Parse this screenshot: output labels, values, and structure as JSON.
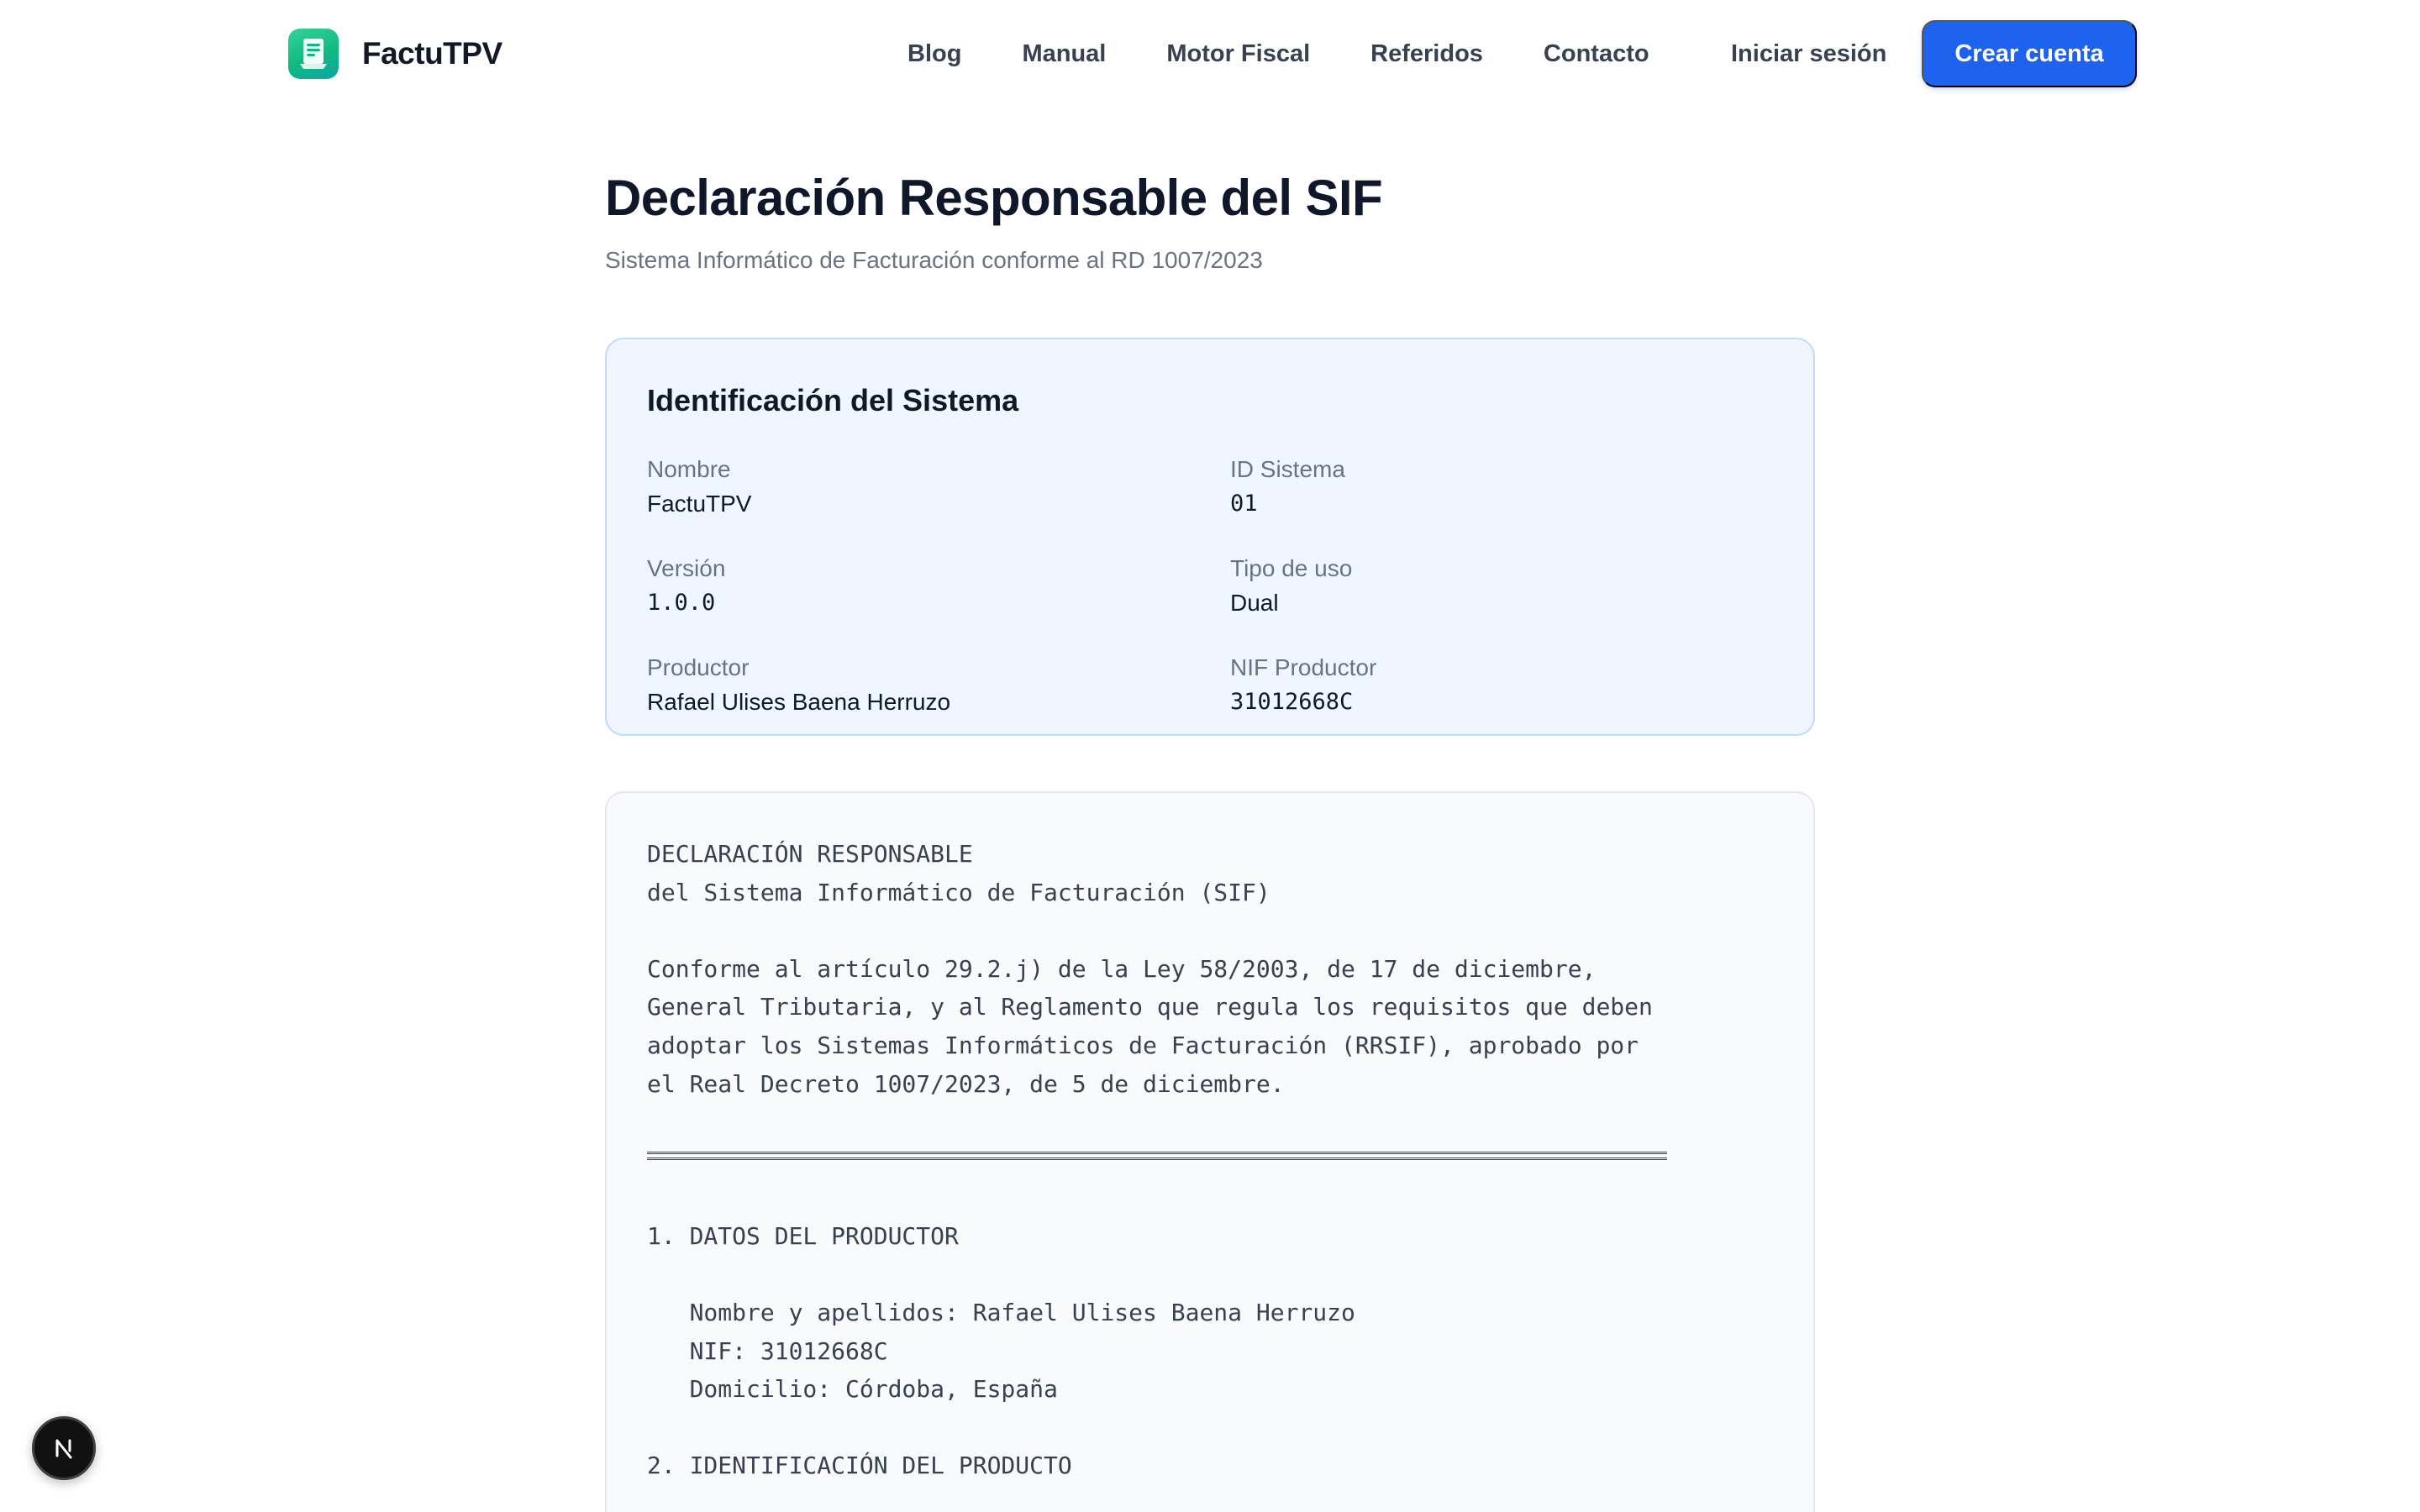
{
  "header": {
    "brand": "FactuTPV",
    "nav": [
      "Blog",
      "Manual",
      "Motor Fiscal",
      "Referidos",
      "Contacto"
    ],
    "login": "Iniciar sesión",
    "cta": "Crear cuenta"
  },
  "page": {
    "title": "Declaración Responsable del SIF",
    "subtitle": "Sistema Informático de Facturación conforme al RD 1007/2023"
  },
  "identification": {
    "title": "Identificación del Sistema",
    "fields": [
      {
        "label": "Nombre",
        "value": "FactuTPV"
      },
      {
        "label": "ID Sistema",
        "value": "01"
      },
      {
        "label": "Versión",
        "value": "1.0.0"
      },
      {
        "label": "Tipo de uso",
        "value": "Dual"
      },
      {
        "label": "Productor",
        "value": "Rafael Ulises Baena Herruzo"
      },
      {
        "label": "NIF Productor",
        "value": "31012668C"
      }
    ]
  },
  "declaration": {
    "heading1": "DECLARACIÓN RESPONSABLE",
    "heading2": "del Sistema Informático de Facturación (SIF)",
    "intro": [
      "Conforme al artículo 29.2.j) de la Ley 58/2003, de 17 de diciembre,",
      "General Tributaria, y al Reglamento que regula los requisitos que deben",
      "adoptar los Sistemas Informáticos de Facturación (RRSIF), aprobado por",
      "el Real Decreto 1007/2023, de 5 de diciembre."
    ],
    "section1_title": "1. DATOS DEL PRODUCTOR",
    "section1_lines": [
      "   Nombre y apellidos: Rafael Ulises Baena Herruzo",
      "   NIF: 31012668C",
      "   Domicilio: Córdoba, España"
    ],
    "section2_title": "2. IDENTIFICACIÓN DEL PRODUCTO"
  },
  "badge": {
    "letter": "N"
  }
}
